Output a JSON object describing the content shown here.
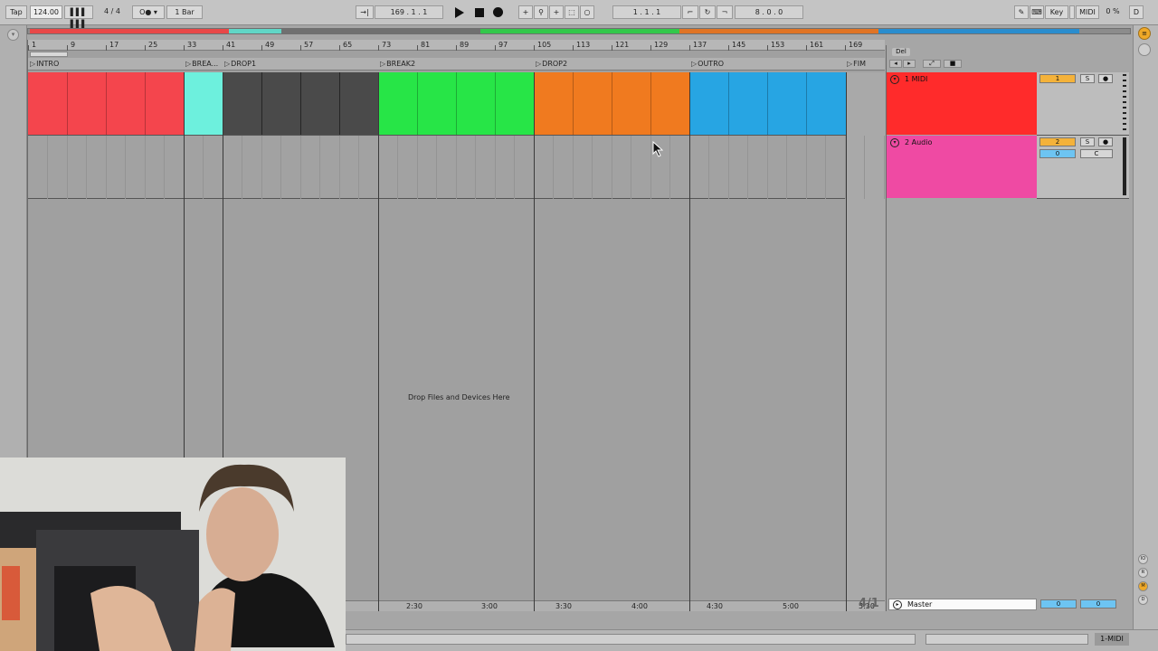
{
  "topbar": {
    "tap": "Tap",
    "tempo": "124.00",
    "signature": "4 / 4",
    "quantize": "1 Bar",
    "arrangement_position": "169 .  1 .  1",
    "loop_start": "1 .  1 .  1",
    "loop_length": "8 .  0 .  0",
    "key_label": "Key",
    "midi_label": "MIDI",
    "cpu": "0 %",
    "d_label": "D"
  },
  "ruler": {
    "bars": [
      "1",
      "9",
      "17",
      "25",
      "33",
      "41",
      "49",
      "57",
      "65",
      "73",
      "81",
      "89",
      "97",
      "105",
      "113",
      "121",
      "129",
      "137",
      "145",
      "153",
      "161",
      "169"
    ],
    "times": [
      "2:30",
      "3:00",
      "3:30",
      "4:00",
      "4:30",
      "5:00",
      "5:30"
    ]
  },
  "locators": [
    "INTRO",
    "BREA...",
    "DROP1",
    "BREAK2",
    "DROP2",
    "OUTRO",
    "FIM"
  ],
  "arrangement": {
    "drop_hint": "Drop Files and Devices Here",
    "time_signature_marker": "4/1"
  },
  "tracks": [
    {
      "name": "1 MIDI",
      "number": "1",
      "solo": "S",
      "color": "#ff2b2b"
    },
    {
      "name": "2 Audio",
      "number": "2",
      "solo": "S",
      "volume": "0",
      "pan": "C",
      "color": "#ef4aa3"
    }
  ],
  "master": {
    "name": "Master",
    "volume": "0",
    "pan": "0"
  },
  "headers": {
    "del_label": "Del"
  },
  "colors": {
    "intro": "#f4454d",
    "break1": "#6df0dd",
    "drop1": "#4a4a4a",
    "break2": "#27e547",
    "drop2": "#f07a1f",
    "outro": "#27a5e3"
  },
  "bottom": {
    "track_indicator": "1-MIDI"
  },
  "icons": [
    "play-icon",
    "stop-icon",
    "record-icon",
    "pencil-icon",
    "keyboard-icon",
    "menu-icon"
  ]
}
